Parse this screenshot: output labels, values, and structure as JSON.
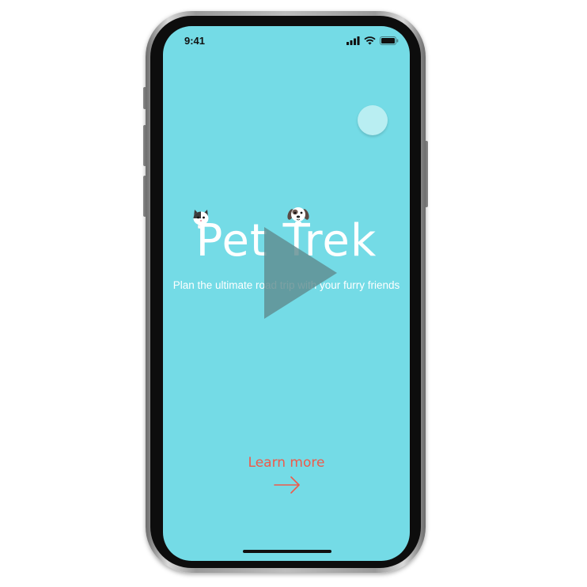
{
  "status_bar": {
    "time": "9:41",
    "icons": [
      "cellular-signal-icon",
      "wifi-icon",
      "battery-icon"
    ]
  },
  "hero": {
    "title": "Pet Trek",
    "tagline": "Plan the ultimate road trip with your furry friends",
    "mascots": [
      "cat-icon",
      "dog-icon"
    ]
  },
  "video": {
    "overlay": "play-icon"
  },
  "cta": {
    "label": "Learn more",
    "icon": "arrow-right-icon"
  },
  "colors": {
    "background": "#74dbe6",
    "title": "#ffffff",
    "accent": "#ef5a4a",
    "play_overlay": "#5f8c90"
  }
}
